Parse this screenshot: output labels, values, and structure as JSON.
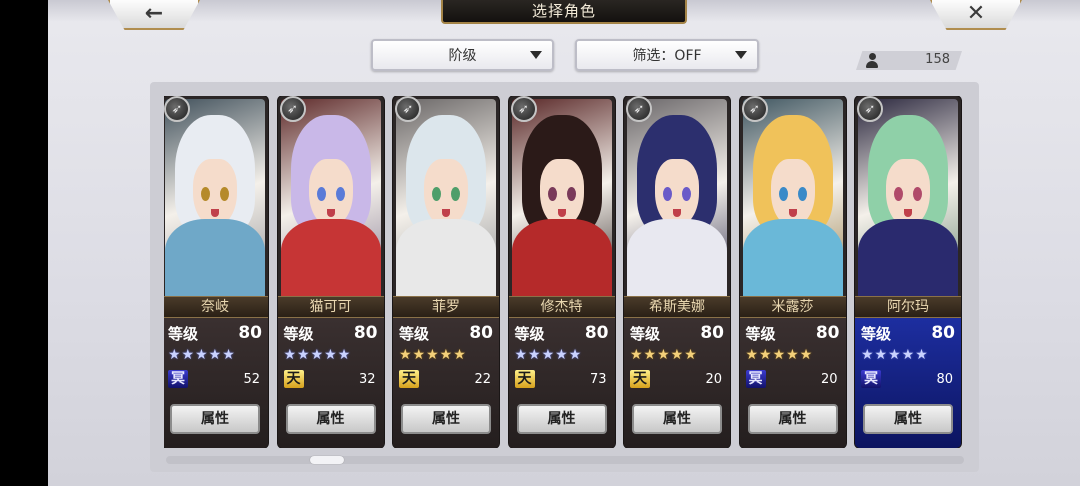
{
  "header": {
    "title": "选择角色",
    "back_icon": "←",
    "close_icon": "✕"
  },
  "filters": {
    "rank_label": "阶级",
    "filter_label": "筛选：OFF"
  },
  "roster_count": "158",
  "attr_label": "属性",
  "level_label": "等级",
  "cards": [
    {
      "name": "奈岐",
      "level": "80",
      "stars": "★★★★★",
      "star_color": "silver",
      "rank": "冥",
      "rank_type": "dark",
      "count": "52",
      "hair": "#e8ecf2",
      "eyes": "#b58a2a",
      "outfit": "#6fa8c8"
    },
    {
      "name": "猫可可",
      "level": "80",
      "stars": "★★★★★",
      "star_color": "silver",
      "rank": "天",
      "rank_type": "heaven",
      "count": "32",
      "hair": "#c9b8e8",
      "eyes": "#5a7bd8",
      "outfit": "#c63535"
    },
    {
      "name": "菲罗",
      "level": "80",
      "stars": "★★★★★",
      "star_color": "gold",
      "rank": "天",
      "rank_type": "heaven",
      "count": "22",
      "hair": "#dce6ec",
      "eyes": "#4e9e6a",
      "outfit": "#e8e8e8"
    },
    {
      "name": "修杰特",
      "level": "80",
      "stars": "★★★★★",
      "star_color": "silver",
      "rank": "天",
      "rank_type": "heaven",
      "count": "73",
      "hair": "#2b1a18",
      "eyes": "#7a3a5a",
      "outfit": "#b52a2a"
    },
    {
      "name": "希斯美娜",
      "level": "80",
      "stars": "★★★★★",
      "star_color": "gold",
      "rank": "天",
      "rank_type": "heaven",
      "count": "20",
      "hair": "#2c2f6e",
      "eyes": "#6a5ac8",
      "outfit": "#e8e8f0"
    },
    {
      "name": "米露莎",
      "level": "80",
      "stars": "★★★★★",
      "star_color": "gold",
      "rank": "冥",
      "rank_type": "dark",
      "count": "20",
      "hair": "#f0c25a",
      "eyes": "#3a8ac8",
      "outfit": "#6ab8d8"
    },
    {
      "name": "阿尔玛",
      "level": "80",
      "stars": "★★★★★",
      "star_color": "silver",
      "rank": "冥",
      "rank_type": "dark",
      "count": "80",
      "hair": "#8fd0a8",
      "eyes": "#b04a6a",
      "outfit": "#2a2a6e"
    }
  ]
}
